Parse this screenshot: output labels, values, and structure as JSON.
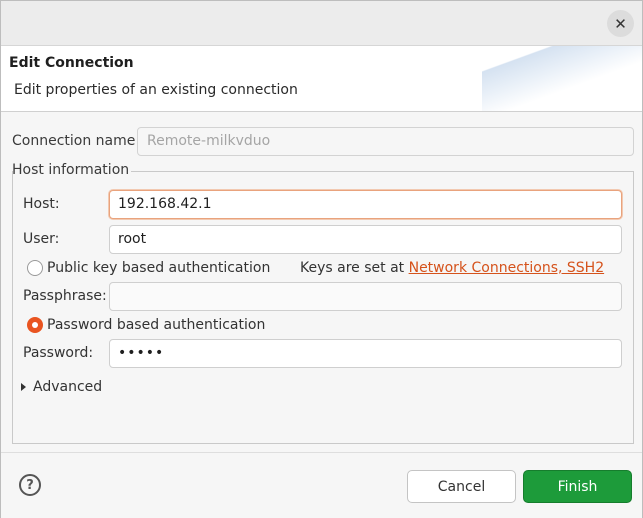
{
  "window": {
    "close_glyph": "✕"
  },
  "header": {
    "title": "Edit Connection",
    "subtitle": "Edit properties of an existing connection"
  },
  "connection": {
    "label": "Connection name:",
    "value": "Remote-milkvduo"
  },
  "host_info": {
    "group_label": "Host information",
    "host_label": "Host:",
    "host_value": "192.168.42.1",
    "user_label": "User:",
    "user_value": "root",
    "pubkey_label": "Public key based authentication",
    "keys_note": "Keys are set at ",
    "keys_link": "Network Connections, SSH2",
    "passphrase_label": "Passphrase:",
    "passphrase_value": "",
    "password_auth_label": "Password based authentication",
    "password_label": "Password:",
    "password_value": "•••••",
    "advanced_label": "Advanced"
  },
  "footer": {
    "help_glyph": "?",
    "cancel_label": "Cancel",
    "finish_label": "Finish"
  },
  "colors": {
    "accent": "#e95420",
    "finish": "#1d9b3a",
    "link": "#d5521b"
  }
}
